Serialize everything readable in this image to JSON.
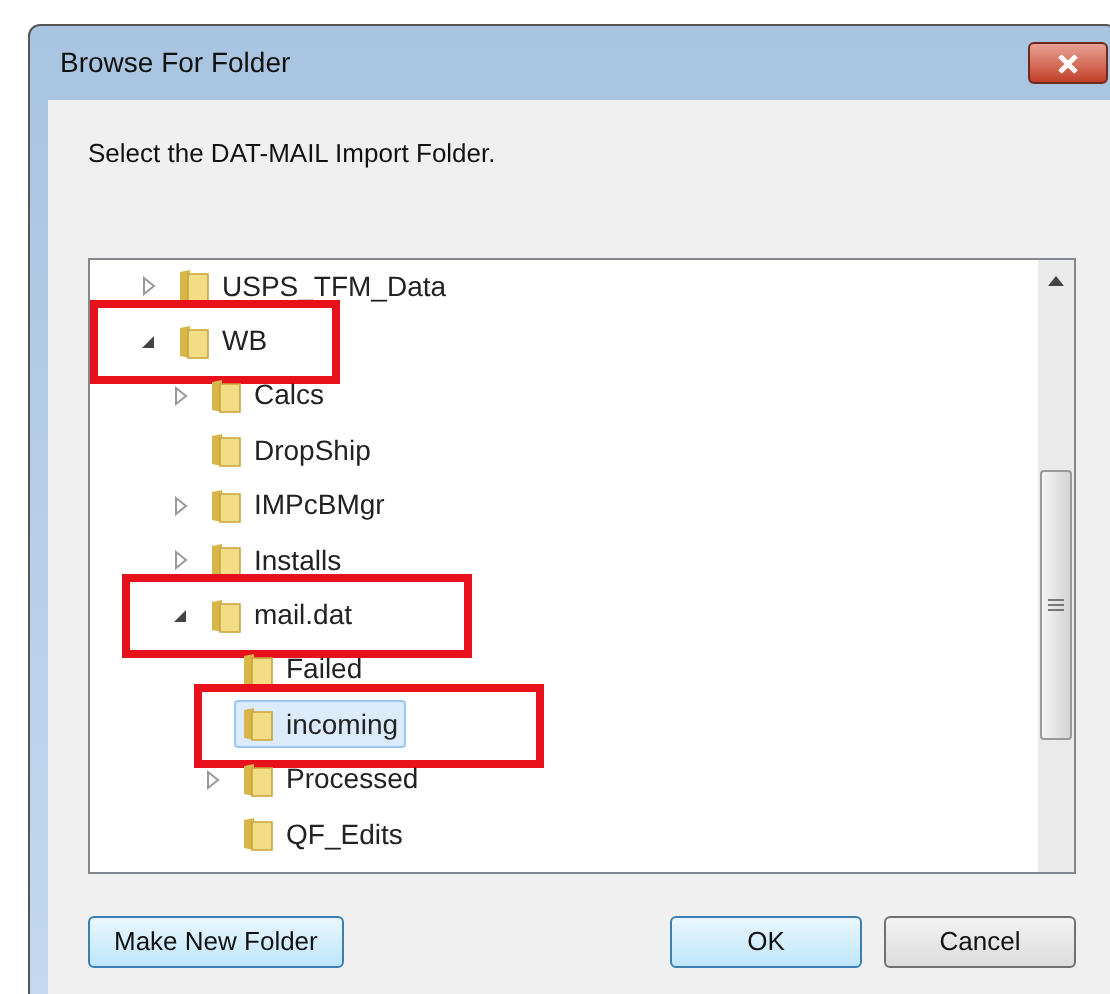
{
  "window": {
    "title": "Browse For Folder"
  },
  "instruction": "Select the DAT-MAIL Import Folder.",
  "tree": [
    {
      "label": "USPS_TFM_Data",
      "expandable": true,
      "expanded": false,
      "selected": false,
      "highlighted": false
    },
    {
      "label": "WB",
      "expandable": true,
      "expanded": true,
      "selected": false,
      "highlighted": true,
      "children": [
        {
          "label": "Calcs",
          "expandable": true,
          "expanded": false,
          "selected": false,
          "highlighted": false
        },
        {
          "label": "DropShip",
          "expandable": false,
          "expanded": false,
          "selected": false,
          "highlighted": false
        },
        {
          "label": "IMPcBMgr",
          "expandable": true,
          "expanded": false,
          "selected": false,
          "highlighted": false
        },
        {
          "label": "Installs",
          "expandable": true,
          "expanded": false,
          "selected": false,
          "highlighted": false
        },
        {
          "label": "mail.dat",
          "expandable": true,
          "expanded": true,
          "selected": false,
          "highlighted": true,
          "children": [
            {
              "label": "Failed",
              "expandable": false,
              "expanded": false,
              "selected": false,
              "highlighted": false
            },
            {
              "label": "incoming",
              "expandable": false,
              "expanded": false,
              "selected": true,
              "highlighted": true
            },
            {
              "label": "Processed",
              "expandable": true,
              "expanded": false,
              "selected": false,
              "highlighted": false
            },
            {
              "label": "QF_Edits",
              "expandable": false,
              "expanded": false,
              "selected": false,
              "highlighted": false
            }
          ]
        }
      ]
    }
  ],
  "buttons": [
    {
      "label": "Make New Folder",
      "kind": "left",
      "focused": true
    },
    {
      "label": "OK",
      "kind": "right",
      "focused": true
    },
    {
      "label": "Cancel",
      "kind": "right",
      "focused": false
    }
  ]
}
